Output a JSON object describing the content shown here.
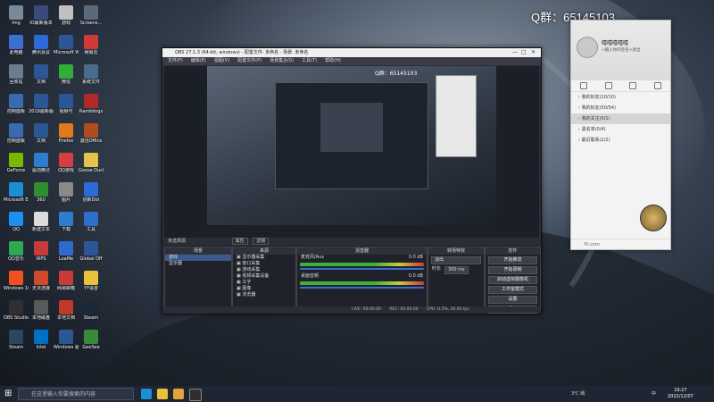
{
  "qgroup_text": "Q群：65145103",
  "desktop_icons": [
    {
      "label": "Img",
      "color": "#7a8a9a"
    },
    {
      "label": "IO最新版本",
      "color": "#3a4a7a"
    },
    {
      "label": "游戏",
      "color": "#c0c0c0"
    },
    {
      "label": "Screens...",
      "color": "#5a6a7a"
    },
    {
      "label": "此电脑",
      "color": "#3b6fd0"
    },
    {
      "label": "腾讯会议",
      "color": "#2a6ad9"
    },
    {
      "label": "Microsoft Word",
      "color": "#2b5797"
    },
    {
      "label": "网易云",
      "color": "#d23a3a"
    },
    {
      "label": "回收站",
      "color": "#6b7c8e"
    },
    {
      "label": "文档",
      "color": "#2b5797"
    },
    {
      "label": "微信",
      "color": "#2fae3a"
    },
    {
      "label": "系统文件",
      "color": "#4a6b8a"
    },
    {
      "label": "控制面板",
      "color": "#3a6ab0"
    },
    {
      "label": "2019最新版",
      "color": "#2b5797"
    },
    {
      "label": "视频号",
      "color": "#2b5797"
    },
    {
      "label": "Ramblings",
      "color": "#b02a2a"
    },
    {
      "label": "控制面板",
      "color": "#3a6ab0"
    },
    {
      "label": "文档",
      "color": "#2b5797"
    },
    {
      "label": "Firefox",
      "color": "#e07a1a"
    },
    {
      "label": "激活Office",
      "color": "#b24b1e"
    },
    {
      "label": "GeForce",
      "color": "#76b900"
    },
    {
      "label": "驱动精灵",
      "color": "#2b7dd0"
    },
    {
      "label": "QQ游戏",
      "color": "#d33f3f"
    },
    {
      "label": "Goose Duck",
      "color": "#e3c24d"
    },
    {
      "label": "Microsoft Edge",
      "color": "#1a8fd6"
    },
    {
      "label": "360",
      "color": "#2f8f2f"
    },
    {
      "label": "图片",
      "color": "#8a8a8a"
    },
    {
      "label": "创新Dot",
      "color": "#2f6ad9"
    },
    {
      "label": "QQ",
      "color": "#1c8ff0"
    },
    {
      "label": "新建文本",
      "color": "#dcdcdc"
    },
    {
      "label": "下载",
      "color": "#2b7dd0"
    },
    {
      "label": "工具",
      "color": "#2c71c7"
    },
    {
      "label": "QQ音乐",
      "color": "#2ea855"
    },
    {
      "label": "WPS",
      "color": "#c93a3a"
    },
    {
      "label": "LoaMe",
      "color": "#2d6ac9"
    },
    {
      "label": "Global Off",
      "color": "#2b5797"
    },
    {
      "label": "Windows 10",
      "color": "#f25022"
    },
    {
      "label": "无法连接",
      "color": "#d04a2a"
    },
    {
      "label": "网易邮箱",
      "color": "#c93a3a"
    },
    {
      "label": "YY语音",
      "color": "#e8c23a"
    },
    {
      "label": "OBS Studio",
      "color": "#302e31"
    },
    {
      "label": "本地磁盘",
      "color": "#5a5a5a"
    },
    {
      "label": "本地文档",
      "color": "#c0392b"
    },
    {
      "label": "Steam",
      "color": "#1b2838"
    },
    {
      "label": "Steam",
      "color": "#2a475e"
    },
    {
      "label": "Intel",
      "color": "#0071c5"
    },
    {
      "label": "Windows 驱动",
      "color": "#2b5797"
    },
    {
      "label": "GeeSee",
      "color": "#3a8a3a"
    }
  ],
  "obs": {
    "title": "OBS 27.1.3 (64-bit, windows) - 配置文件: 未命名 - 场景: 未命名",
    "menu": [
      "文件(F)",
      "编辑(E)",
      "视图(V)",
      "配置文件(P)",
      "场景集合(S)",
      "工具(T)",
      "帮助(H)"
    ],
    "source_bar": "未选择源",
    "source_props": "属性",
    "source_filters": "滤镜",
    "docks": {
      "scenes": {
        "title": "场景",
        "items": [
          "游戏",
          "显示器"
        ]
      },
      "sources": {
        "title": "来源",
        "items": [
          "显示器采集",
          "窗口采集",
          "游戏采集",
          "视频采集设备",
          "文字",
          "图像",
          "浏览器"
        ]
      },
      "mixer": {
        "title": "混音器",
        "tracks": [
          {
            "name": "麦克风/Aux",
            "db": "0.0 dB"
          },
          {
            "name": "桌面音频",
            "db": "0.0 dB"
          }
        ]
      },
      "transitions": {
        "title": "转场特效",
        "type": "淡出",
        "duration_label": "时长",
        "duration": "300 ms"
      },
      "controls": {
        "title": "控件",
        "buttons": [
          "开始推流",
          "开始录制",
          "启动虚拟摄像机",
          "工作室模式",
          "设置",
          "退出"
        ]
      }
    },
    "status": {
      "live": "LIVE: 00:00:00",
      "rec": "REC: 00:00:00",
      "cpu": "CPU: 0.5%, 30.00 fps"
    }
  },
  "qq": {
    "name": "嘻嘻嘻嘻嘻",
    "signature": "<输入你的签名>退出",
    "groups": [
      {
        "label": "我的好友(10/10)",
        "selected": false
      },
      {
        "label": "我的好友(50/54)",
        "selected": false
      },
      {
        "label": "我的关注(0/1)",
        "selected": true
      },
      {
        "label": "黑名单(0/4)",
        "selected": false
      },
      {
        "label": "最近联系(2/2)",
        "selected": false
      }
    ],
    "bottom": "Yii.com"
  },
  "taskbar": {
    "search_placeholder": "在这里输入你要搜索的内容",
    "weather": "3℃ 晴",
    "ime": "中",
    "time": "19:27",
    "date": "2022/12/07"
  }
}
